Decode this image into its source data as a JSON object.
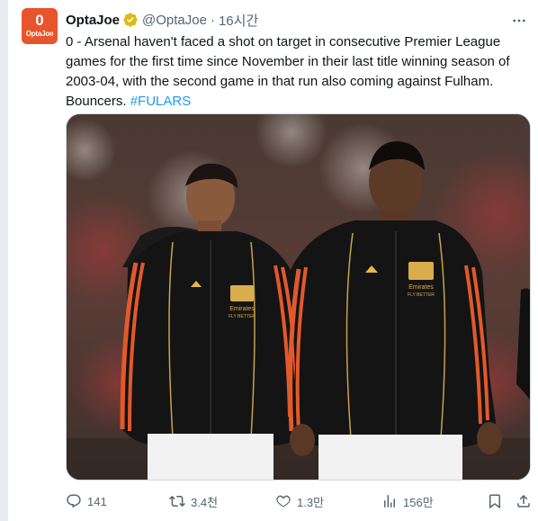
{
  "tweet": {
    "avatar_text_big": "0",
    "avatar_text_small": "OptaJoe",
    "author_name": "OptaJoe",
    "handle": "@OptaJoe",
    "separator": "·",
    "timestamp": "16시간",
    "text_main": "0 - Arsenal haven't faced a shot on target in consecutive Premier League games for the first time since November in their last title winning season of 2003-04, with the second game in that run also coming against Fulham. Bouncers. ",
    "hashtag": "#FULARS",
    "media": {
      "kit_sponsor": "Emirates",
      "kit_sponsor_sub": "FLY BETTER"
    }
  },
  "actions": {
    "replies": "141",
    "reposts": "3.4천",
    "likes": "1.3만",
    "views": "156만"
  },
  "colors": {
    "brand": "#e8542b",
    "link": "#1d9bf0",
    "verified": "#e2b719",
    "muted": "#536471"
  }
}
